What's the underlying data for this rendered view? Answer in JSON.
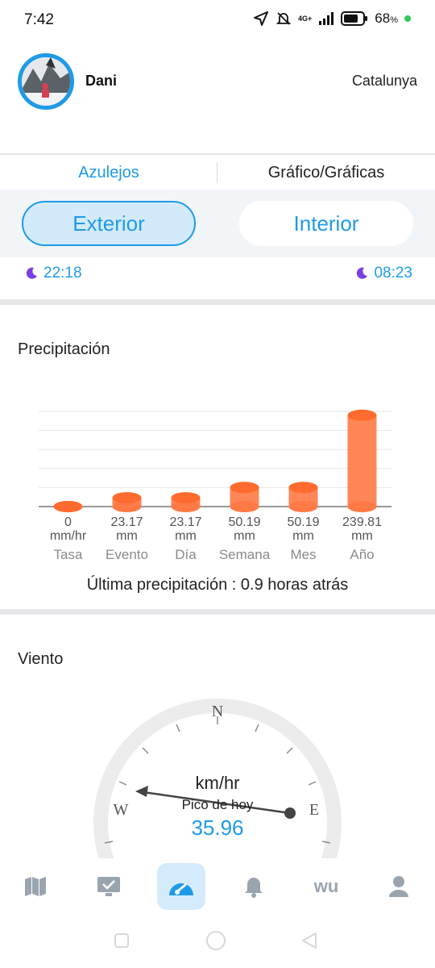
{
  "status": {
    "time": "7:42",
    "network": "4G+",
    "battery": "68",
    "battery_suffix": "%",
    "icons": [
      "location-icon",
      "mute-bell-icon",
      "signal-icon",
      "battery-icon"
    ]
  },
  "profile": {
    "name": "Dani",
    "region": "Catalunya"
  },
  "tabs": {
    "tiles": "Azulejos",
    "chart": "Gráfico/Gráficas"
  },
  "segment": {
    "exterior": "Exterior",
    "interior": "Interior",
    "selected": "Exterior"
  },
  "moon_times": {
    "left": "22:18",
    "right": "08:23"
  },
  "precipitation": {
    "title": "Precipitación",
    "last_rain": "Última precipitación : 0.9 horas atrás"
  },
  "chart_data": {
    "type": "bar",
    "categories": [
      "Tasa",
      "Evento",
      "Día",
      "Semana",
      "Mes",
      "Año"
    ],
    "values": [
      0,
      23.17,
      23.17,
      50.19,
      50.19,
      239.81
    ],
    "value_labels": [
      "0",
      "23.17",
      "23.17",
      "50.19",
      "50.19",
      "239.81"
    ],
    "units": [
      "mm/hr",
      "mm",
      "mm",
      "mm",
      "mm",
      "mm"
    ],
    "ylim": [
      0,
      250
    ],
    "grid": true,
    "color": "#ff7a45"
  },
  "wind": {
    "title": "Viento",
    "unit": "km/hr",
    "label": "Pico de hoy",
    "value": "35.96",
    "direction": "W",
    "compass": [
      "N",
      "E",
      "W"
    ]
  },
  "bottom_nav": {
    "items": [
      "map-icon",
      "dashboard-display-icon",
      "gauge-icon",
      "bell-icon",
      "wu-logo-icon",
      "user-icon"
    ],
    "active": "gauge-icon",
    "wu_text": "wu"
  },
  "colors": {
    "accent": "#1e9be6",
    "bar": "#ff7a45",
    "moon": "#7b3fe4"
  }
}
